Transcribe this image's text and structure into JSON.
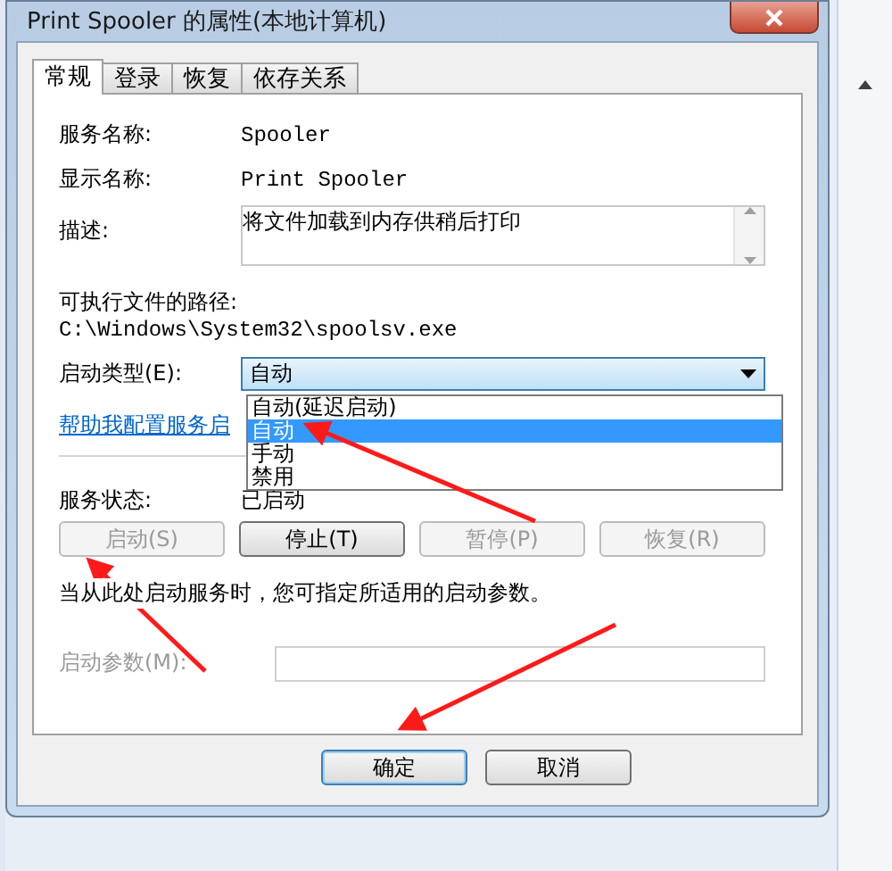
{
  "window": {
    "title": "Print Spooler 的属性(本地计算机)"
  },
  "tabs": [
    {
      "label": "常规",
      "selected": true
    },
    {
      "label": "登录",
      "selected": false
    },
    {
      "label": "恢复",
      "selected": false
    },
    {
      "label": "依存关系",
      "selected": false
    }
  ],
  "fields": [
    {
      "kind": "text",
      "label": "服务名称:",
      "value": "Spooler"
    },
    {
      "kind": "text",
      "label": "显示名称:",
      "value": "Print Spooler"
    },
    {
      "kind": "textarea",
      "label": "描述:",
      "value": "将文件加载到内存供稍后打印"
    }
  ],
  "path": {
    "label": "可执行文件的路径:",
    "value": "C:\\Windows\\System32\\spoolsv.exe"
  },
  "startup_type": {
    "label": "启动类型(E):",
    "value": "自动",
    "expanded": true,
    "options": [
      {
        "label": "自动(延迟启动)",
        "selected": false
      },
      {
        "label": "自动",
        "selected": true
      },
      {
        "label": "手动",
        "selected": false
      },
      {
        "label": "禁用",
        "selected": false
      }
    ]
  },
  "help_link": "帮助我配置服务启",
  "service_status": {
    "label": "服务状态:",
    "value": "已启动"
  },
  "service_buttons": [
    {
      "label": "启动(S)",
      "disabled": true
    },
    {
      "label": "停止(T)",
      "disabled": false
    },
    {
      "label": "暂停(P)",
      "disabled": true
    },
    {
      "label": "恢复(R)",
      "disabled": true
    }
  ],
  "hint": "当从此处启动服务时，您可指定所适用的启动参数。",
  "start_parameters": {
    "label": "启动参数(M):",
    "disabled": true
  },
  "dialog_buttons": [
    {
      "label": "确定",
      "default": true
    },
    {
      "label": "取消",
      "default": false
    }
  ]
}
